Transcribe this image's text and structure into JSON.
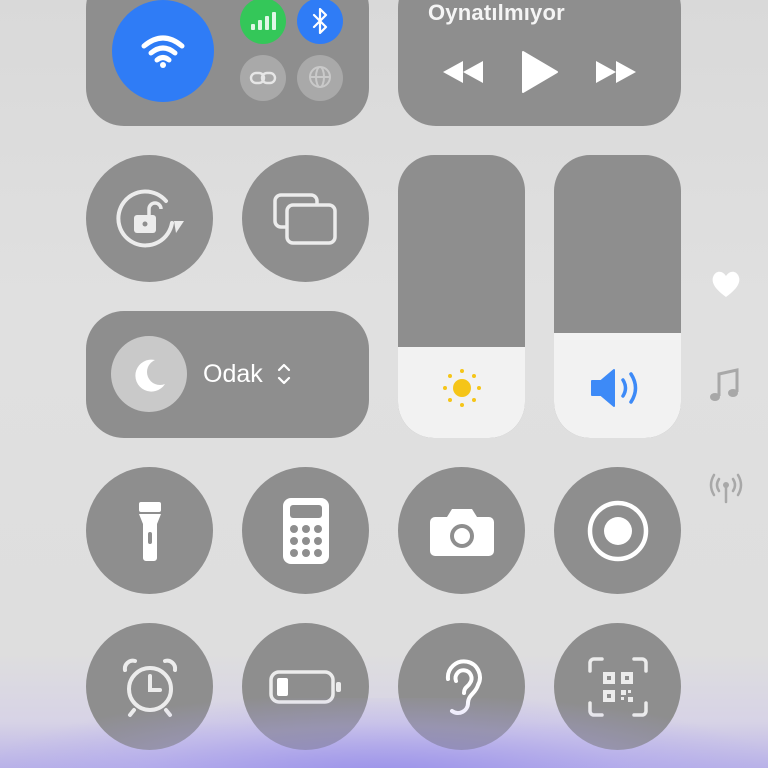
{
  "connectivity": {
    "wifi": {
      "icon": "wifi-icon",
      "state": "on",
      "color": "#2F7CF6"
    },
    "cellular": {
      "icon": "cellular-icon",
      "state": "on",
      "color": "#34C759"
    },
    "bluetooth": {
      "icon": "bluetooth-icon",
      "state": "on",
      "color": "#2F7CF6"
    },
    "personal_hotspot": {
      "icon": "link-icon",
      "state": "off"
    },
    "vpn": {
      "icon": "globe-icon",
      "state": "off"
    }
  },
  "media": {
    "title": "Oynatılmıyor",
    "controls": [
      "rewind-icon",
      "play-icon",
      "fast-forward-icon"
    ]
  },
  "toggles": [
    {
      "name": "orientation-lock",
      "icon": "rotation-lock-icon"
    },
    {
      "name": "screen-mirroring",
      "icon": "screen-mirroring-icon"
    },
    {
      "name": "flashlight",
      "icon": "flashlight-icon"
    },
    {
      "name": "calculator",
      "icon": "calculator-icon"
    },
    {
      "name": "camera",
      "icon": "camera-icon"
    },
    {
      "name": "screen-recording",
      "icon": "record-icon"
    },
    {
      "name": "alarm",
      "icon": "alarm-clock-icon"
    },
    {
      "name": "low-power-mode",
      "icon": "battery-icon"
    },
    {
      "name": "hearing",
      "icon": "ear-icon"
    },
    {
      "name": "code-scanner",
      "icon": "qr-code-icon"
    }
  ],
  "focus": {
    "label": "Odak",
    "icon": "moon-icon"
  },
  "brightness": {
    "level": 0.32,
    "icon": "sun-icon",
    "icon_color": "#F5C518"
  },
  "volume": {
    "level": 0.37,
    "icon": "speaker-icon",
    "icon_color": "#3D8AF7"
  },
  "side_indicators": [
    "heart-icon",
    "music-note-icon",
    "antenna-icon"
  ],
  "colors": {
    "tile": "#8E8E8E",
    "background": "#DEDEDE",
    "accent_blue": "#2F7CF6",
    "accent_green": "#34C759"
  }
}
